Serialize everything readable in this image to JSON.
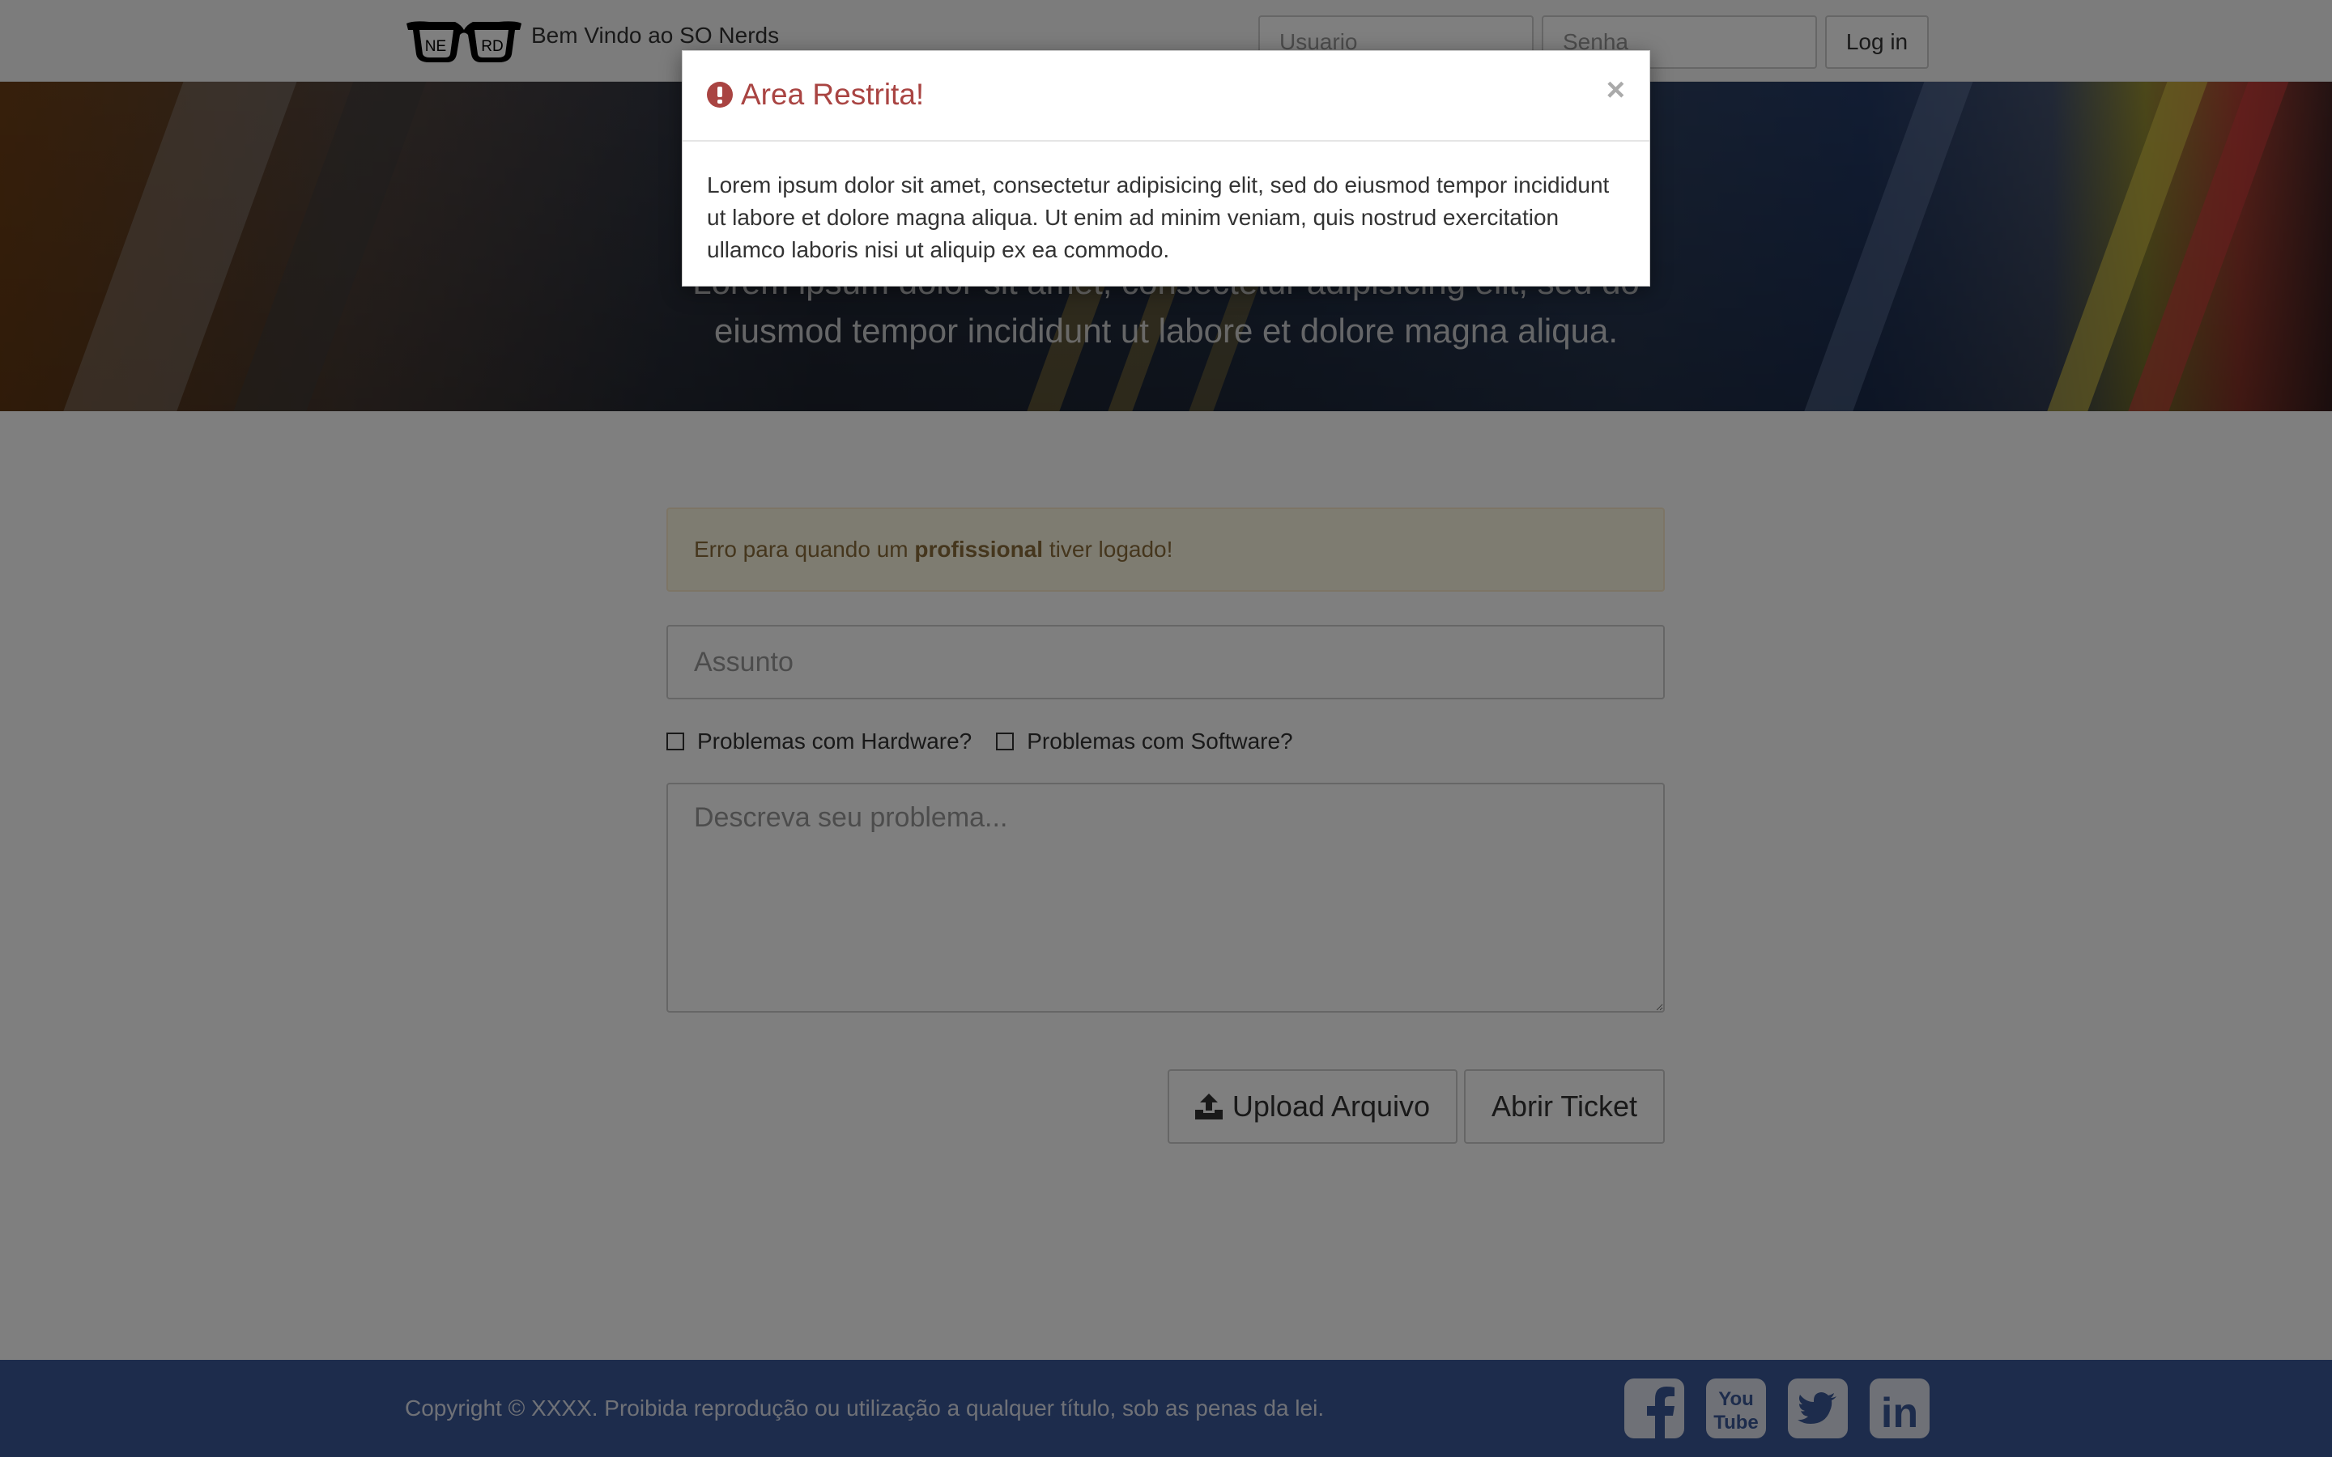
{
  "navbar": {
    "logo_letters": [
      "NE",
      "RD"
    ],
    "brand_text": "Bem Vindo ao SO Nerds",
    "username_placeholder": "Usuario",
    "password_placeholder": "Senha",
    "login_label": "Log in"
  },
  "hero": {
    "title": "Lorem ipsum dolor sit amet, consectetur adipisicing elit, sed do eiusmod tempor incididunt ut labore et dolore magna aliqua."
  },
  "form": {
    "alert": {
      "prefix": "Erro para quando um ",
      "bold": "profissional",
      "suffix": " tiver logado!"
    },
    "subject_placeholder": "Assunto",
    "checkbox_hardware": "Problemas com Hardware?",
    "checkbox_software": "Problemas com Software?",
    "description_placeholder": "Descreva seu problema...",
    "upload_label": "Upload Arquivo",
    "submit_label": "Abrir Ticket",
    "upload_icon": "upload-icon"
  },
  "footer": {
    "copyright": "Copyright © XXXX. Proibida reprodução ou utilização a qualquer título, sob as penas da lei.",
    "social_icons": [
      "facebook-icon",
      "youtube-icon",
      "twitter-icon",
      "linkedin-icon"
    ],
    "youtube_text": [
      "You",
      "Tube"
    ],
    "linkedin_text": "in"
  },
  "modal": {
    "title": "Area Restrita!",
    "close_symbol": "×",
    "body": "Lorem ipsum dolor sit amet, consectetur adipisicing elit, sed do eiusmod tempor incididunt ut labore et dolore magna aliqua. Ut enim ad minim veniam, quis nostrud exercitation ullamco laboris nisi ut aliquip ex ea commodo.",
    "title_color": "#a94442"
  },
  "colors": {
    "footer_bg": "#3b5998",
    "alert_bg": "#fcf8e3",
    "alert_text": "#8a6d3b"
  }
}
